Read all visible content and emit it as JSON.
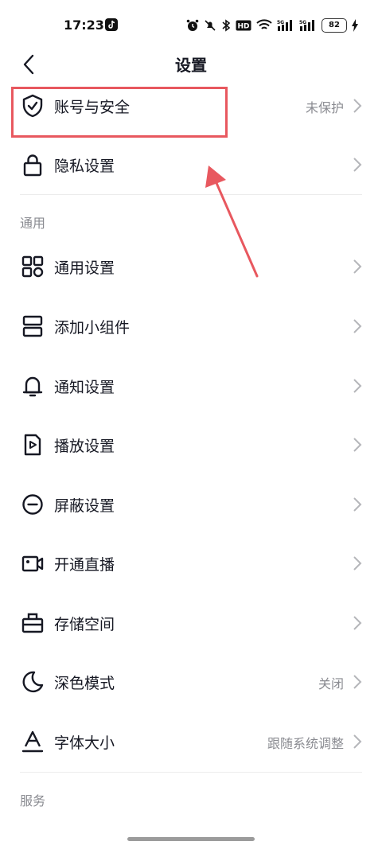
{
  "status_bar": {
    "time": "17:23",
    "battery": "82",
    "icons": [
      "tiktok-icon",
      "alarm-icon",
      "mute-icon",
      "bluetooth-icon",
      "hd-icon",
      "wifi-icon",
      "signal-5g-icon",
      "signal-5g-icon",
      "charging-icon"
    ]
  },
  "header": {
    "title": "设置",
    "back_icon": "chevron-left-icon"
  },
  "account_section": {
    "items": [
      {
        "label": "账号与安全",
        "value": "未保护",
        "icon": "shield-check-icon"
      },
      {
        "label": "隐私设置",
        "value": "",
        "icon": "lock-icon"
      }
    ]
  },
  "general_section": {
    "title": "通用",
    "items": [
      {
        "label": "通用设置",
        "value": "",
        "icon": "grid-icon"
      },
      {
        "label": "添加小组件",
        "value": "",
        "icon": "widget-icon"
      },
      {
        "label": "通知设置",
        "value": "",
        "icon": "bell-icon"
      },
      {
        "label": "播放设置",
        "value": "",
        "icon": "play-file-icon"
      },
      {
        "label": "屏蔽设置",
        "value": "",
        "icon": "block-icon"
      },
      {
        "label": "开通直播",
        "value": "",
        "icon": "video-camera-icon"
      },
      {
        "label": "存储空间",
        "value": "",
        "icon": "storage-box-icon"
      },
      {
        "label": "深色模式",
        "value": "关闭",
        "icon": "moon-icon"
      },
      {
        "label": "字体大小",
        "value": "跟随系统调整",
        "icon": "font-size-icon"
      }
    ]
  },
  "service_section": {
    "title": "服务"
  },
  "annotation": {
    "highlight_color": "#e8585f"
  }
}
